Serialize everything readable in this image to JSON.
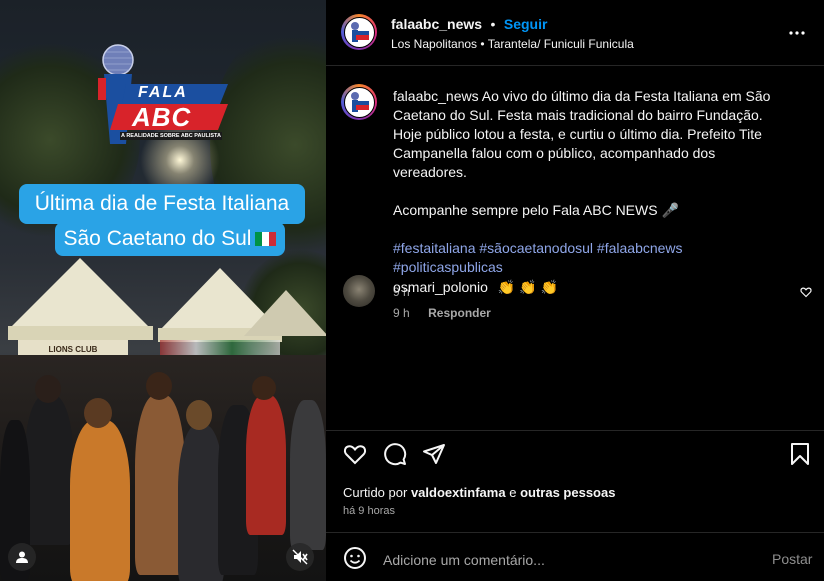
{
  "media": {
    "logo_top": "FALA",
    "logo_main": "ABC",
    "logo_tagline": "A REALIDADE SOBRE ABC PAULISTA",
    "banner_line1": "Última dia de Festa Italiana em",
    "banner_line2": "São Caetano do Sul",
    "tent_sign": "LIONS CLUB",
    "flag_colors": [
      "#009246",
      "#ffffff",
      "#ce2b37"
    ]
  },
  "header": {
    "username": "falaabc_news",
    "dot": "•",
    "follow_label": "Seguir",
    "subtitle": "Los Napolitanos • Tarantela/ Funiculi Funicula",
    "more_icon": "more-horizontal-icon"
  },
  "caption": {
    "username": "falaabc_news",
    "text_part1": "Ao vivo do último dia da Festa Italiana em São Caetano do Sul. Festa mais tradicional do bairro Fundação. Hoje público lotou a festa, e curtiu o último dia. Prefeito Tite Campanella falou com o público, acompanhado dos vereadores.",
    "text_part2": "Acompanhe sempre pelo Fala ABC NEWS 🎤",
    "hashtags": "#festaitaliana #sãocaetanodosul #falaabcnews #politicaspublicas",
    "time": "9 h"
  },
  "comment": {
    "username": "osmari_polonio",
    "text": "👏 👏 👏",
    "time": "9 h",
    "reply_label": "Responder"
  },
  "actions": {
    "liked_prefix": "Curtido por",
    "liked_user": "valdoextinfama",
    "liked_and": "e",
    "liked_others": "outras pessoas",
    "timestamp": "há 9 horas"
  },
  "add_comment": {
    "placeholder": "Adicione um comentário...",
    "post_label": "Postar"
  },
  "colors": {
    "accent_link": "#0095f6",
    "hashtag": "#8fa6e8",
    "banner": "#2aa3e6",
    "logo_red": "#d8232a",
    "logo_blue": "#1b4fa0"
  }
}
